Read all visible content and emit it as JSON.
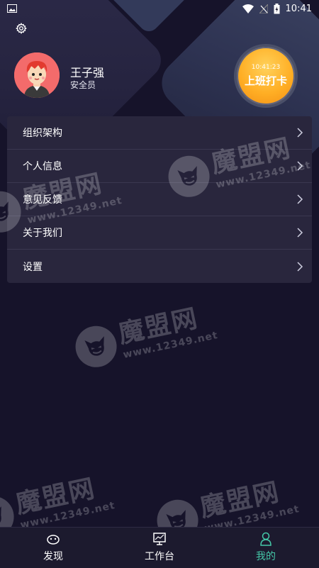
{
  "status_bar": {
    "time": "10:41",
    "icons": [
      "image-icon",
      "wifi-icon",
      "no-signal-icon",
      "battery-charging-icon"
    ]
  },
  "settings_icon": "gear-icon",
  "profile": {
    "name": "王子强",
    "role": "安全员",
    "avatar_icon": "avatar-boy-red-hair"
  },
  "clock_button": {
    "time": "10:41:23",
    "label": "上班打卡",
    "color": "#ffae24"
  },
  "menu": {
    "items": [
      {
        "label": "组织架构"
      },
      {
        "label": "个人信息"
      },
      {
        "label": "意见反馈"
      },
      {
        "label": "关于我们"
      },
      {
        "label": "设置"
      }
    ]
  },
  "watermark": {
    "name": "魔盟网",
    "url": "www.12349.net"
  },
  "bottom_nav": {
    "items": [
      {
        "label": "发现",
        "icon": "discover-icon"
      },
      {
        "label": "工作台",
        "icon": "workbench-icon"
      },
      {
        "label": "我的",
        "icon": "profile-icon",
        "active": true
      }
    ],
    "active_color": "#45c8a8"
  }
}
